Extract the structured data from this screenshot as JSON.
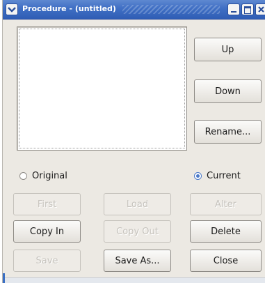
{
  "window": {
    "title": "Procedure - (untitled)"
  },
  "buttons": {
    "up": "Up",
    "down": "Down",
    "rename": "Rename...",
    "first": "First",
    "load": "Load",
    "alter": "Alter",
    "copy_in": "Copy In",
    "copy_out": "Copy Out",
    "delete": "Delete",
    "save": "Save",
    "save_as": "Save As...",
    "close": "Close"
  },
  "radios": {
    "original": {
      "label": "Original",
      "checked": false
    },
    "current": {
      "label": "Current",
      "checked": true
    }
  },
  "colors": {
    "titlebar": "#3f6fc4",
    "window_bg": "#ece9e3",
    "radio_accent": "#4a78c8",
    "disabled_text": "#c6c3bd"
  },
  "icons": {
    "window_menu": "chevron-down-icon",
    "minimize": "minimize-icon",
    "maximize": "maximize-icon",
    "close": "close-icon"
  }
}
